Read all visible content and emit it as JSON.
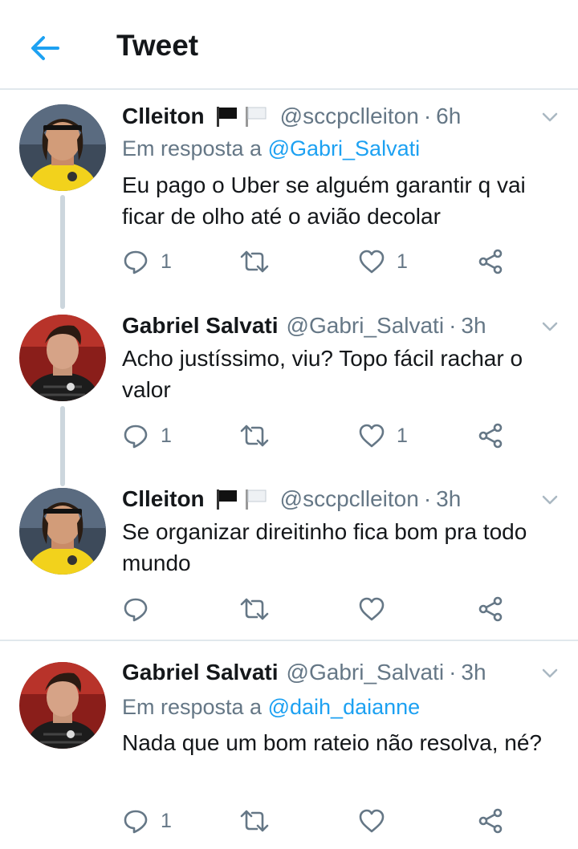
{
  "header": {
    "title": "Tweet",
    "back_icon": "arrow-left-icon",
    "accent": "#1da1f2"
  },
  "tweets": [
    {
      "name": "Clleiton",
      "handle": "@sccpclleiton",
      "time": "6h",
      "has_flags": true,
      "reply_prefix": "Em resposta a",
      "reply_mention": "@Gabri_Salvati",
      "text": "Eu pago o Uber se alguém garantir q vai ficar de olho até o avião decolar",
      "reply_count": "1",
      "retweet_count": "",
      "like_count": "1"
    },
    {
      "name": "Gabriel Salvati",
      "handle": "@Gabri_Salvati",
      "time": "3h",
      "text": "Acho justíssimo, viu? Topo fácil rachar o valor",
      "reply_count": "1",
      "retweet_count": "",
      "like_count": "1"
    },
    {
      "name": "Clleiton",
      "handle": "@sccpclleiton",
      "time": "3h",
      "has_flags": true,
      "text": "Se organizar direitinho fica bom pra todo mundo",
      "reply_count": "",
      "retweet_count": "",
      "like_count": ""
    },
    {
      "name": "Gabriel Salvati",
      "handle": "@Gabri_Salvati",
      "time": "3h",
      "reply_prefix": "Em resposta a",
      "reply_mention": "@daih_daianne",
      "text": "Nada que um bom rateio não resolva, né?",
      "reply_count": "1",
      "retweet_count": "",
      "like_count": ""
    }
  ],
  "colors": {
    "text": "#14171a",
    "muted": "#657786",
    "link": "#1da1f2",
    "thread_line": "#ccd6dd",
    "divider": "#e1e8ed"
  }
}
